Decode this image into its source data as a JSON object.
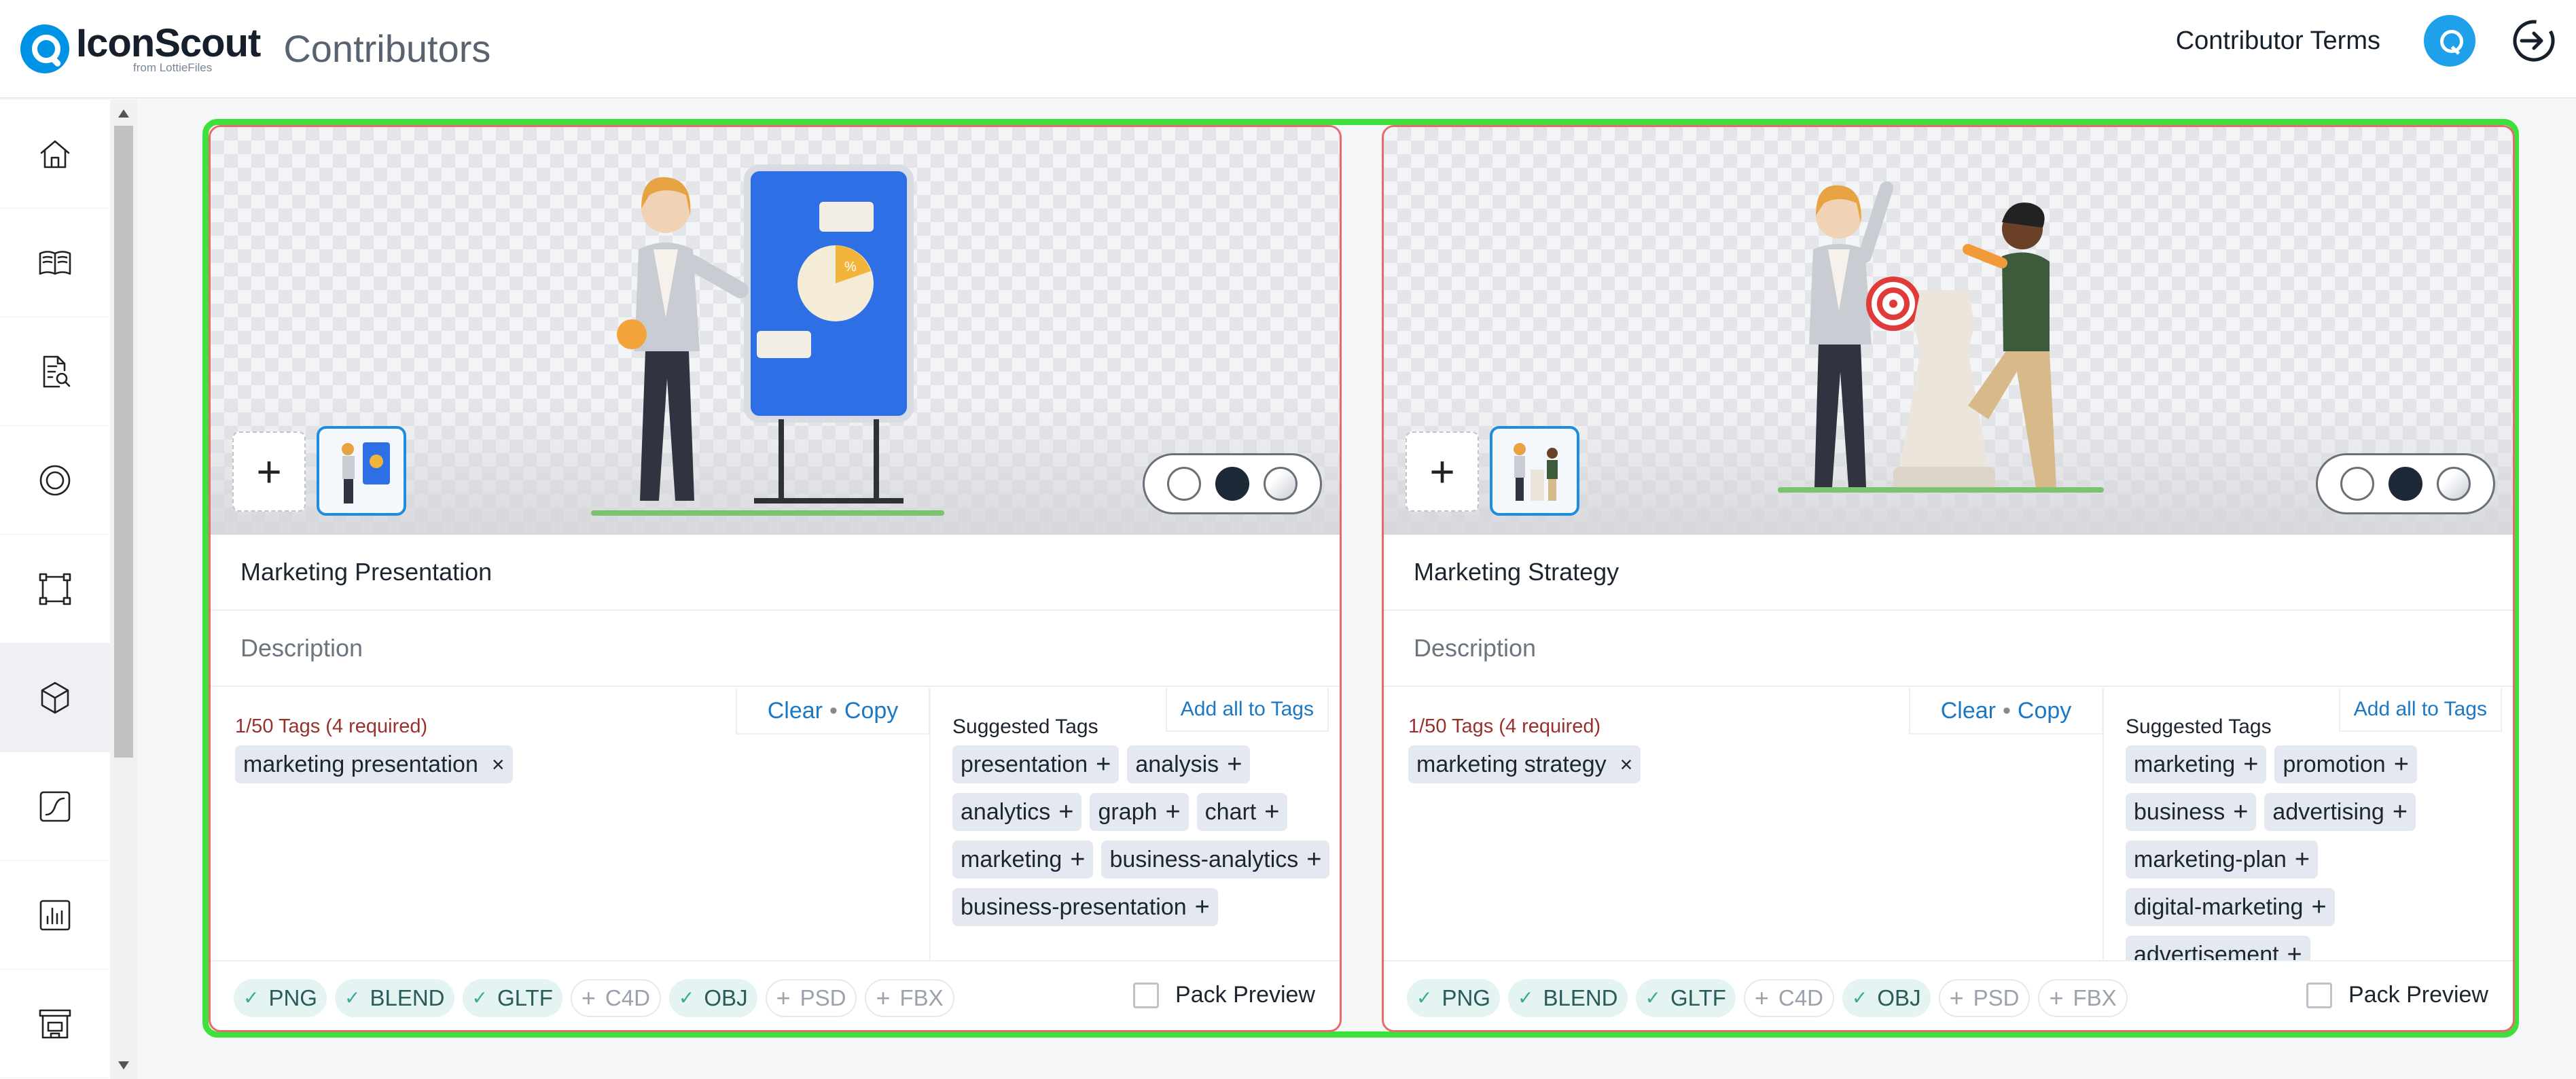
{
  "header": {
    "logo_name": "IconScout",
    "logo_sub": "from LottieFiles",
    "app_title": "Contributors",
    "terms_label": "Contributor Terms"
  },
  "sidebar": {
    "items": [
      {
        "icon": "home-icon"
      },
      {
        "icon": "book-icon"
      },
      {
        "icon": "document-search-icon"
      },
      {
        "icon": "lottie-icon"
      },
      {
        "icon": "vector-icon"
      },
      {
        "icon": "3d-cube-icon",
        "active": true
      },
      {
        "icon": "animation-icon"
      },
      {
        "icon": "stats-icon"
      },
      {
        "icon": "shop-icon"
      }
    ]
  },
  "cards": [
    {
      "title": "Marketing Presentation",
      "description_placeholder": "Description",
      "tag_count": "1/50 Tags (4 required)",
      "clear_label": "Clear",
      "copy_label": "Copy",
      "applied_tags": [
        "marketing presentation"
      ],
      "suggested_label": "Suggested Tags",
      "add_all_label": "Add all to Tags",
      "suggested_tags": [
        "presentation",
        "analysis",
        "analytics",
        "graph",
        "chart",
        "marketing",
        "business-analytics",
        "business-presentation"
      ],
      "pack_preview_label": "Pack Preview"
    },
    {
      "title": "Marketing Strategy",
      "description_placeholder": "Description",
      "tag_count": "1/50 Tags (4 required)",
      "clear_label": "Clear",
      "copy_label": "Copy",
      "applied_tags": [
        "marketing strategy"
      ],
      "suggested_label": "Suggested Tags",
      "add_all_label": "Add all to Tags",
      "suggested_tags": [
        "marketing",
        "promotion",
        "business",
        "advertising",
        "marketing-plan",
        "digital-marketing",
        "advertisement"
      ],
      "pack_preview_label": "Pack Preview"
    }
  ],
  "formats": [
    {
      "label": "PNG",
      "enabled": true
    },
    {
      "label": "BLEND",
      "enabled": true
    },
    {
      "label": "GLTF",
      "enabled": true
    },
    {
      "label": "C4D",
      "enabled": false
    },
    {
      "label": "OBJ",
      "enabled": true
    },
    {
      "label": "PSD",
      "enabled": false
    },
    {
      "label": "FBX",
      "enabled": false
    }
  ],
  "colors": {
    "accent": "#1b78c4",
    "selection": "#3ee03c",
    "card_border": "#e96a6a",
    "brand": "#0092e4"
  }
}
